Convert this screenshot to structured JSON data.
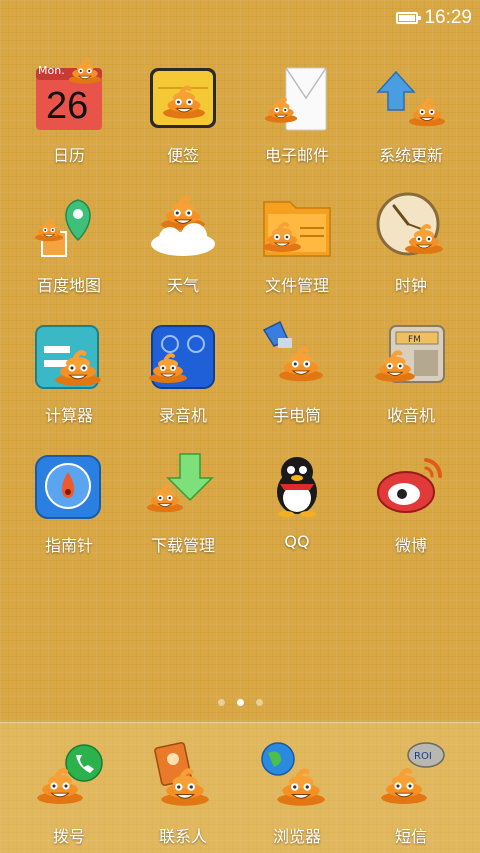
{
  "status_bar": {
    "time": "16:29",
    "battery_icon": "battery-icon"
  },
  "apps": [
    {
      "label": "日历",
      "icon": "calendar-icon",
      "day": "Mon.",
      "date": "26"
    },
    {
      "label": "便签",
      "icon": "notes-icon"
    },
    {
      "label": "电子邮件",
      "icon": "email-icon"
    },
    {
      "label": "系统更新",
      "icon": "update-icon"
    },
    {
      "label": "百度地图",
      "icon": "map-icon"
    },
    {
      "label": "天气",
      "icon": "weather-icon"
    },
    {
      "label": "文件管理",
      "icon": "folder-icon"
    },
    {
      "label": "时钟",
      "icon": "clock-icon"
    },
    {
      "label": "计算器",
      "icon": "calculator-icon"
    },
    {
      "label": "录音机",
      "icon": "recorder-icon"
    },
    {
      "label": "手电筒",
      "icon": "flashlight-icon"
    },
    {
      "label": "收音机",
      "icon": "radio-icon",
      "radio_text": "FM"
    },
    {
      "label": "指南针",
      "icon": "compass-icon"
    },
    {
      "label": "下载管理",
      "icon": "download-icon"
    },
    {
      "label": "QQ",
      "icon": "qq-icon"
    },
    {
      "label": "微博",
      "icon": "weibo-icon"
    }
  ],
  "page_indicator": {
    "count": 3,
    "active": 1
  },
  "dock": [
    {
      "label": "拨号",
      "icon": "phone-icon"
    },
    {
      "label": "联系人",
      "icon": "contacts-icon"
    },
    {
      "label": "浏览器",
      "icon": "browser-icon"
    },
    {
      "label": "短信",
      "icon": "sms-icon",
      "bubble_text": "ROI"
    }
  ],
  "colors": {
    "background": "#d9a845",
    "poop": "#f08a1c",
    "text": "#ffffff"
  }
}
